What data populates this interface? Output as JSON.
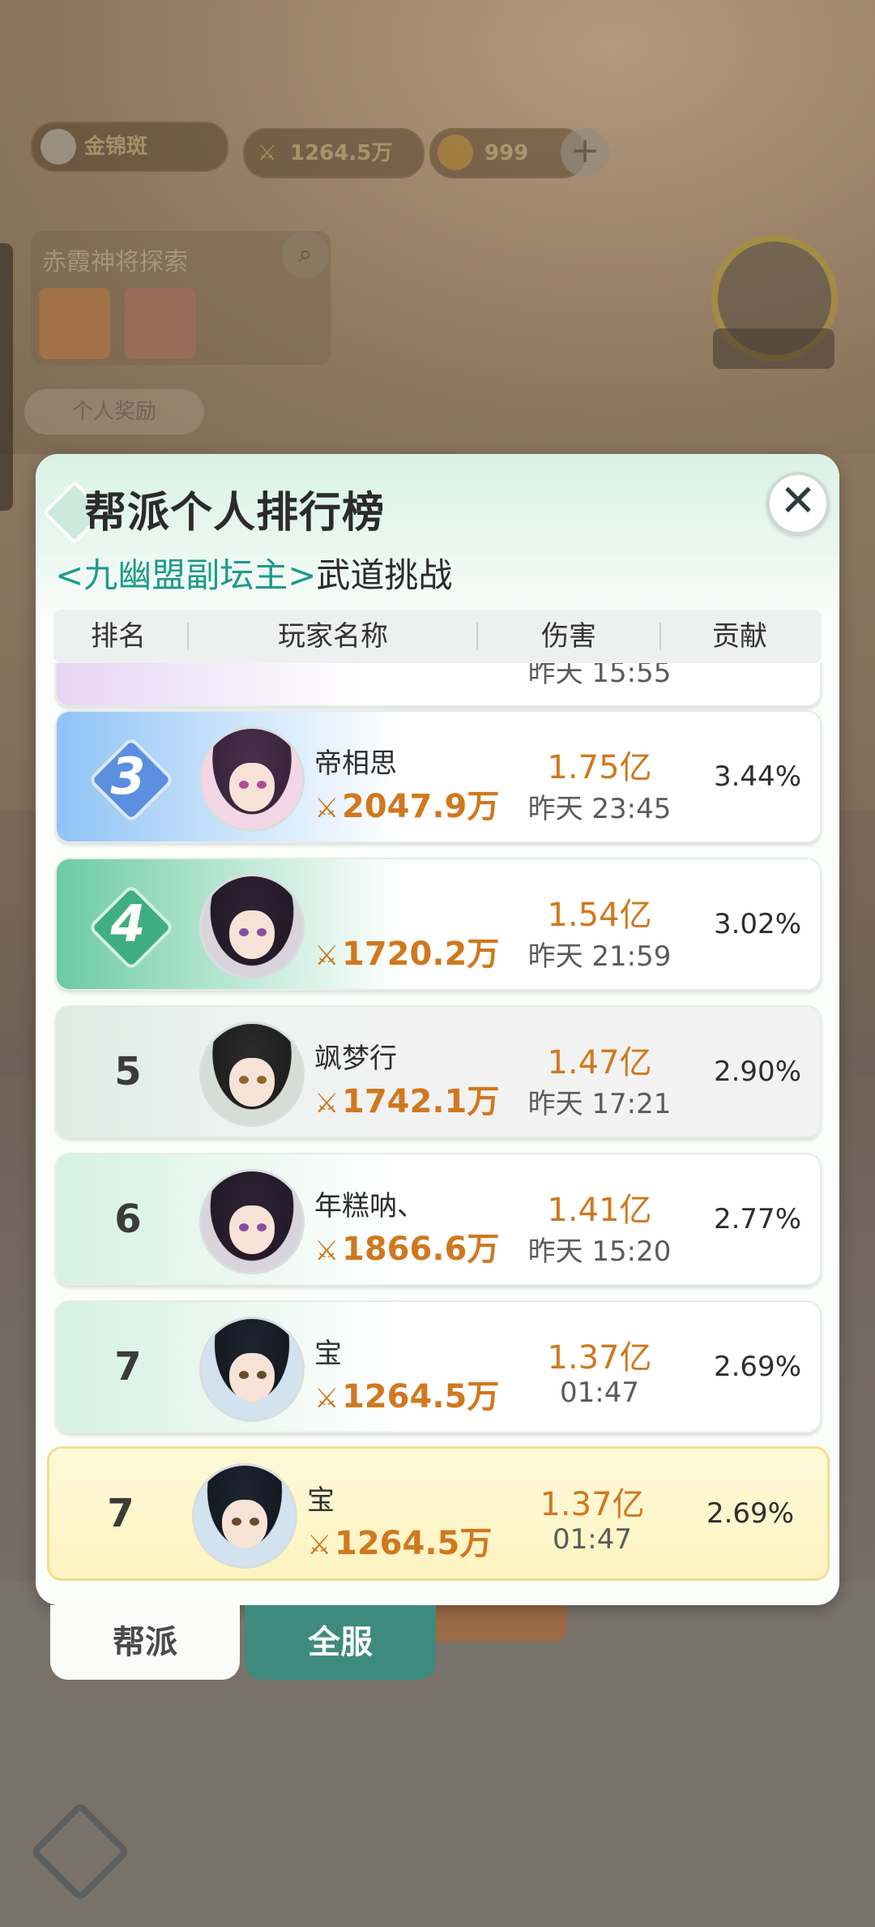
{
  "background": {
    "hud_text_1": "金锦斑",
    "hud_currency": "1264.5万",
    "hud_count": "999",
    "panel_title": "赤霞神将探索",
    "personal_pill": "个人奖励"
  },
  "modal": {
    "title": "帮派个人排行榜",
    "subtitle_guild": "<九幽盟副坛主>",
    "subtitle_event": "武道挑战",
    "close_symbol": "✕",
    "columns": [
      "排名",
      "玩家名称",
      "伤害",
      "贡献"
    ]
  },
  "rows": [
    {
      "rank": "",
      "name": "",
      "power": "",
      "damage": "",
      "time": "昨天 15:55",
      "contribution": ""
    },
    {
      "rank": "3",
      "name": "帝相思",
      "power": "2047.9万",
      "damage": "1.75亿",
      "time": "昨天 23:45",
      "contribution": "3.44%"
    },
    {
      "rank": "4",
      "name": "",
      "power": "1720.2万",
      "damage": "1.54亿",
      "time": "昨天 21:59",
      "contribution": "3.02%"
    },
    {
      "rank": "5",
      "name": "飒梦行",
      "power": "1742.1万",
      "damage": "1.47亿",
      "time": "昨天 17:21",
      "contribution": "2.90%"
    },
    {
      "rank": "6",
      "name": "年糕呐、",
      "power": "1866.6万",
      "damage": "1.41亿",
      "time": "昨天 15:20",
      "contribution": "2.77%"
    },
    {
      "rank": "7",
      "name": "宝",
      "power": "1264.5万",
      "damage": "1.37亿",
      "time": "01:47",
      "contribution": "2.69%"
    }
  ],
  "self_row": {
    "rank": "7",
    "name": "宝",
    "power": "1264.5万",
    "damage": "1.37亿",
    "time": "01:47",
    "contribution": "2.69%"
  },
  "tabs": {
    "guild": "帮派",
    "server": "全服",
    "active": "server"
  },
  "colors": {
    "accent": "#1f9a8c",
    "power": "#d1781f",
    "rank3": "#5c8fe0",
    "rank4": "#3fae84",
    "self_highlight": "#fdf3c2"
  },
  "icons": {
    "power": "crossed-swords-icon",
    "close": "close-icon"
  }
}
